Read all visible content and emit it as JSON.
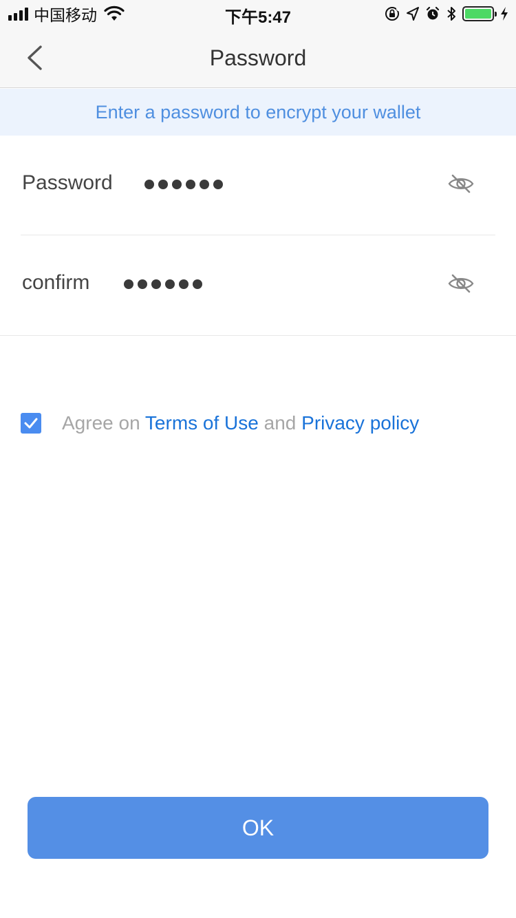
{
  "status_bar": {
    "carrier": "中国移动",
    "time": "下午5:47",
    "battery_level": 1.0,
    "icons": [
      "signal-icon",
      "wifi-icon",
      "rotation-lock-icon",
      "location-icon",
      "alarm-icon",
      "bluetooth-icon",
      "battery-icon",
      "charging-icon"
    ]
  },
  "nav": {
    "title": "Password",
    "back_icon": "chevron-left-icon"
  },
  "hint": {
    "text": "Enter a password to encrypt your wallet"
  },
  "form": {
    "password": {
      "label": "Password",
      "masked_length": 6,
      "toggle_icon": "eye-off-icon"
    },
    "confirm": {
      "label": "confirm",
      "masked_length": 6,
      "toggle_icon": "eye-off-icon"
    }
  },
  "agreement": {
    "checked": true,
    "prefix": "Agree on",
    "terms": "Terms of Use",
    "conjunction": "and",
    "privacy": "Privacy policy"
  },
  "ok_button": {
    "label": "OK"
  },
  "colors": {
    "accent": "#548fe5",
    "link": "#1a73d9",
    "hint_bg": "#ecf3fd",
    "hint_text": "#4f8fe0",
    "checkbox": "#4a8cf0"
  }
}
